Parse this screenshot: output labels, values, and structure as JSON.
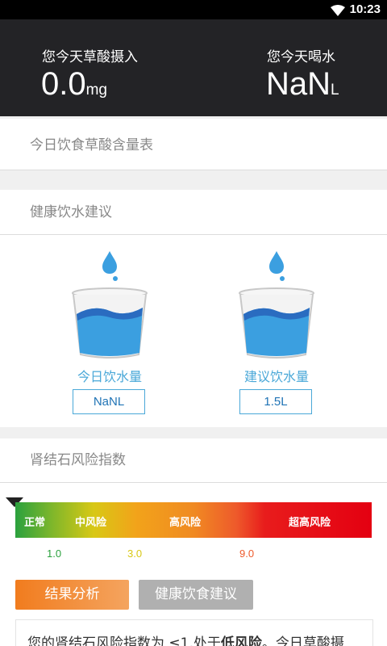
{
  "status_bar": {
    "time": "10:23",
    "wifi_icon": "wifi-icon"
  },
  "header": {
    "oxalate_label": "您今天草酸摄入",
    "oxalate_value": "0.0",
    "oxalate_unit": "mg",
    "water_label": "您今天喝水",
    "water_value": "NaN",
    "water_unit": "L"
  },
  "sections": {
    "oxalate_table": "今日饮食草酸含量表",
    "water_advice": "健康饮水建议",
    "stone_risk": "肾结石风险指数"
  },
  "water": {
    "today_label": "今日饮水量",
    "today_value": "NaNL",
    "suggest_label": "建议饮水量",
    "suggest_value": "1.5L",
    "water_color": "#3b9fe0"
  },
  "risk": {
    "levels": [
      "正常",
      "中风险",
      "高风险",
      "超高风险"
    ],
    "ticks": [
      {
        "label": "1.0",
        "color": "#2ba13e"
      },
      {
        "label": "3.0",
        "color": "#d8c815"
      },
      {
        "label": "9.0",
        "color": "#ee5a2b"
      }
    ]
  },
  "buttons": {
    "analysis": "结果分析",
    "diet_advice": "健康饮食建议"
  },
  "result": {
    "prefix": "您的肾结石风险指数为 ≤1,处于",
    "level": "低风险",
    "suffix": "。今日草酸摄"
  }
}
